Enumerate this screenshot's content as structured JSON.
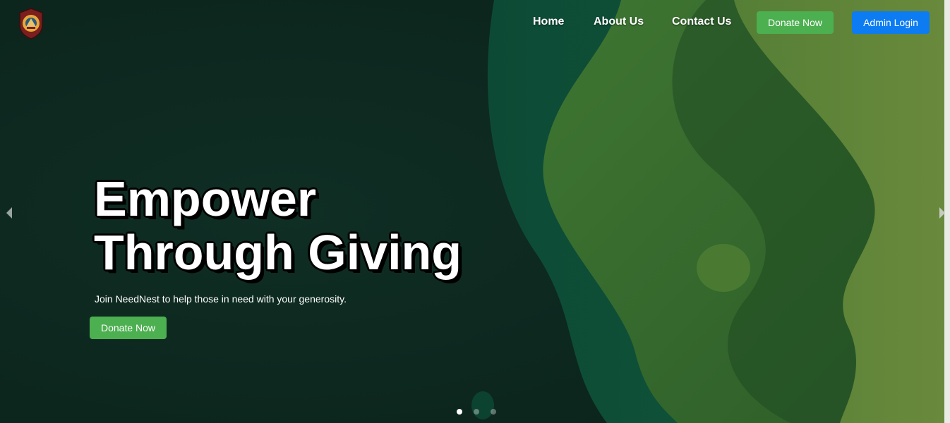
{
  "nav": {
    "links": [
      "Home",
      "About Us",
      "Contact Us"
    ],
    "donate_label": "Donate Now",
    "admin_label": "Admin Login"
  },
  "hero": {
    "headline_line1": "Empower",
    "headline_line2": "Through Giving",
    "subtitle": "Join NeedNest to help those in need with your generosity.",
    "cta_label": "Donate Now"
  },
  "carousel": {
    "slide_count": 3,
    "active_index": 0
  },
  "colors": {
    "primary_green": "#4caf50",
    "admin_blue": "#0d7cf2",
    "dark_bg": "#0f2a22",
    "wave_mid": "#0f4a33",
    "wave_light": "#4a7a32",
    "wave_lightest": "#6a8a3c"
  },
  "icons": {
    "logo": "crest-logo-icon",
    "prev": "chevron-left-icon",
    "next": "chevron-right-icon"
  }
}
